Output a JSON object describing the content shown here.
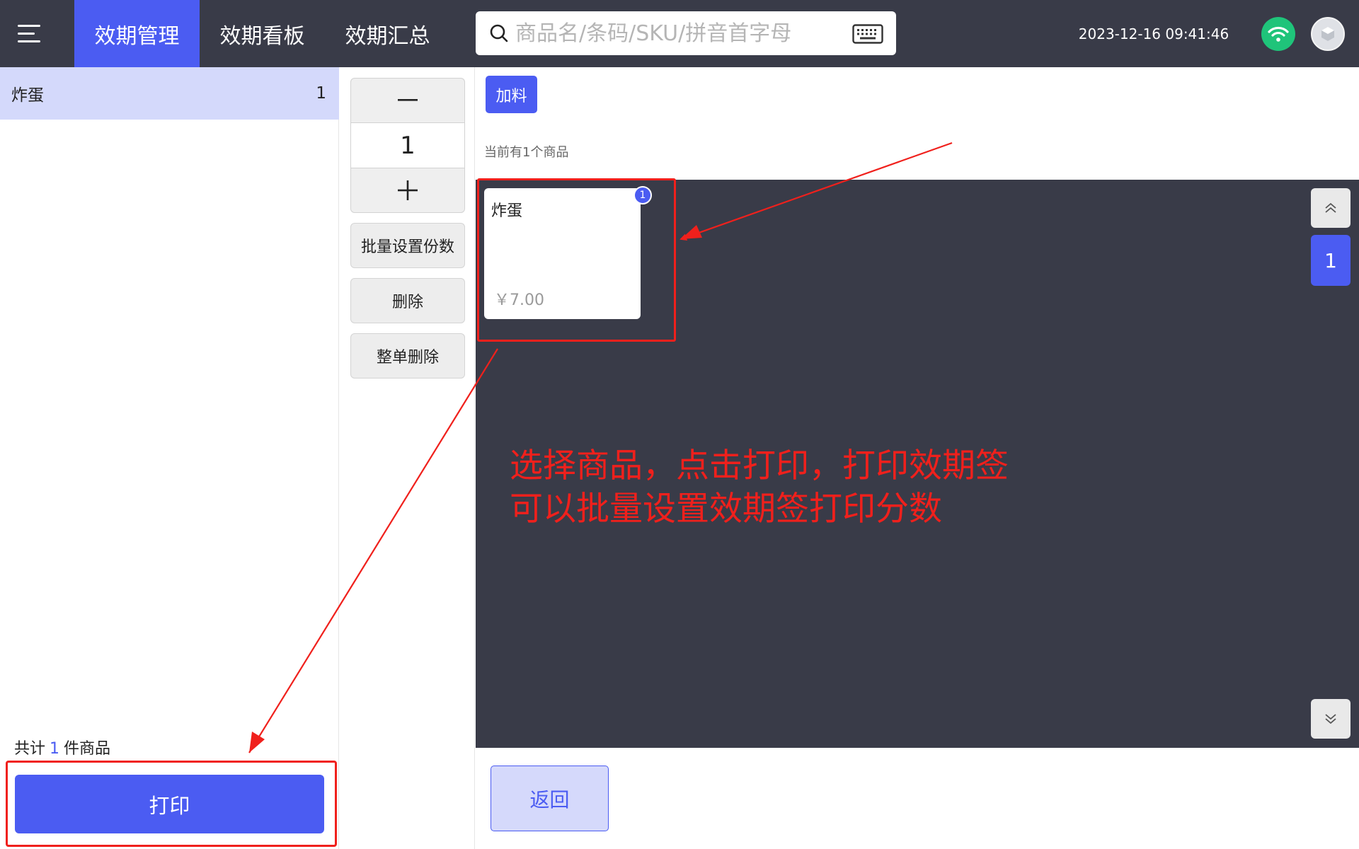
{
  "header": {
    "tabs": [
      {
        "label": "效期管理",
        "active": true
      },
      {
        "label": "效期看板",
        "active": false
      },
      {
        "label": "效期汇总",
        "active": false
      }
    ],
    "search_placeholder": "商品名/条码/SKU/拼音首字母",
    "datetime": "2023-12-16 09:41:46",
    "icons": [
      "menu-icon",
      "search-icon",
      "keyboard-icon",
      "wifi-icon",
      "user-avatar"
    ]
  },
  "order_list": {
    "items": [
      {
        "name": "炸蛋",
        "qty": "1"
      }
    ],
    "total_prefix": "共计",
    "total_count": "1",
    "total_suffix": "件商品",
    "print_label": "打印"
  },
  "controls": {
    "quantity": "1",
    "batch_label": "批量设置份数",
    "delete_label": "删除",
    "delete_all_label": "整单删除"
  },
  "catalog": {
    "category": "加料",
    "count_prefix": "当前有",
    "count_num": "1",
    "count_suffix": "个商品",
    "products": [
      {
        "name": "炸蛋",
        "price": "￥7.00",
        "badge": "1"
      }
    ],
    "current_page": "1",
    "back_label": "返回"
  },
  "annotation": {
    "line1": "选择商品，点击打印，打印效期签",
    "line2": "可以批量设置效期签打印分数"
  },
  "colors": {
    "header_bg": "#393b48",
    "accent": "#4b5cf2",
    "selected_row": "#d4d9fb",
    "annotation_red": "#f0201c",
    "wifi_green": "#1fc47a"
  }
}
